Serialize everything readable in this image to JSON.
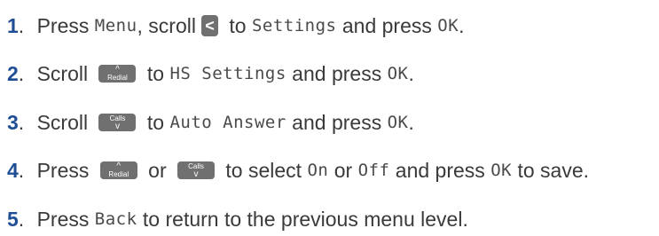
{
  "steps": [
    {
      "number": "1",
      "dot": ".",
      "t1": " Press ",
      "menu": "Menu",
      "t2": ", scroll",
      "key_glyph": "<",
      "t3": " to ",
      "settings": "Settings",
      "t4": " and press ",
      "ok": "OK",
      "t5": "."
    },
    {
      "number": "2",
      "dot": ".",
      "t1": " Scroll ",
      "key_glyph": "^",
      "key_label": "Redial",
      "t2": " to ",
      "hs_settings": "HS Settings",
      "t3": " and press ",
      "ok": "OK",
      "t4": "."
    },
    {
      "number": "3",
      "dot": ".",
      "t1": " Scroll ",
      "key_label": "Calls",
      "key_glyph": "v",
      "t2": " to ",
      "auto_answer": "Auto Answer",
      "t3": " and press ",
      "ok": "OK",
      "t4": "."
    },
    {
      "number": "4",
      "dot": ".",
      "t1": " Press ",
      "key1_glyph": "^",
      "key1_label": "Redial",
      "t2": " or ",
      "key2_label": "Calls",
      "key2_glyph": "v",
      "t3": " to select ",
      "on": "On",
      "t4": " or ",
      "off": "Off",
      "t5": " and press ",
      "ok": "OK",
      "t6": " to save."
    },
    {
      "number": "5",
      "dot": ".",
      "t1": " Press ",
      "back": "Back",
      "t2": " to return to the previous menu level."
    }
  ],
  "colors": {
    "step_number": "#1f4e95",
    "body_text": "#3a3a3a",
    "key_background": "#707070",
    "key_text": "#ffffff"
  }
}
